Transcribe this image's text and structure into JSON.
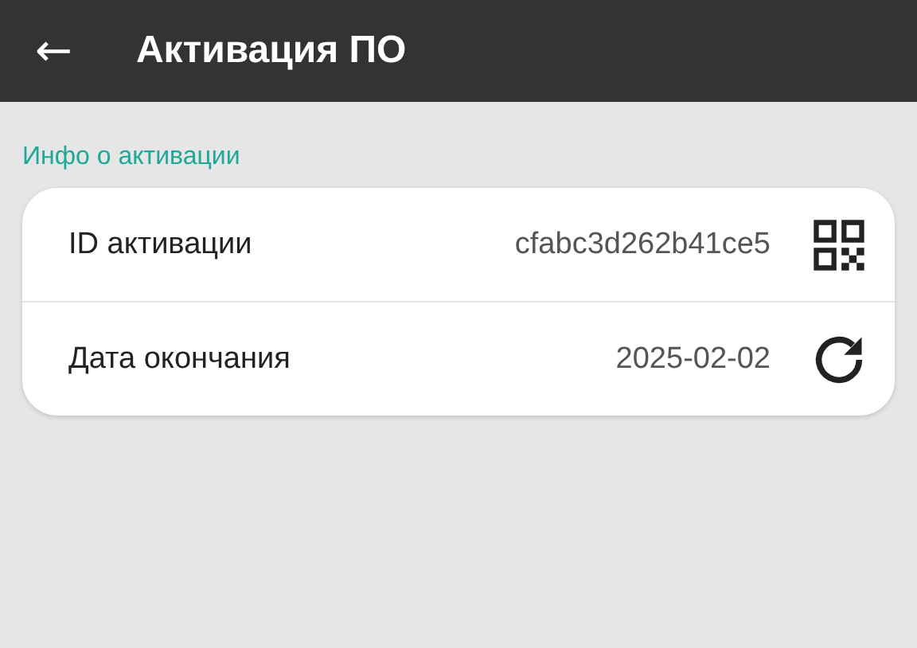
{
  "app_bar": {
    "back_icon": "←",
    "title": "Активация ПО"
  },
  "section": {
    "title": "Инфо о активации"
  },
  "rows": [
    {
      "label": "ID активации",
      "value": "cfabc3d262b41ce5",
      "kind": "qr"
    },
    {
      "label": "Дата окончания",
      "value": "2025-02-02",
      "kind": "refresh"
    }
  ]
}
